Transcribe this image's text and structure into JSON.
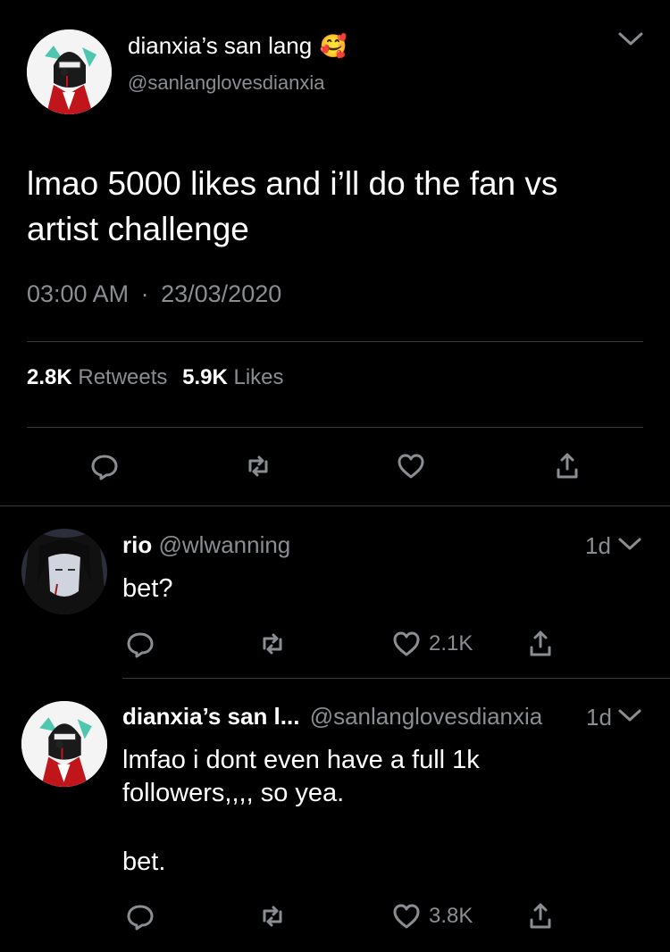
{
  "main_tweet": {
    "display_name": "dianxia’s san lang",
    "display_name_emoji": "🥰",
    "handle": "@sanlanglovesdianxia",
    "text_line1": "lmao 5000 likes and i’ll do the fan vs",
    "text_line2": "artist challenge",
    "time": "03:00 AM",
    "separator": "·",
    "date": "23/03/2020",
    "retweets_count": "2.8K",
    "retweets_label": "Retweets",
    "likes_count": "5.9K",
    "likes_label": "Likes"
  },
  "replies": [
    {
      "name": "rio",
      "handle": "@wlwanning",
      "age": "1d",
      "text": "bet?",
      "like_count": "2.1K"
    },
    {
      "name": "dianxia’s san l...",
      "handle": "@sanlanglovesdianxia",
      "age": "1d",
      "text_line1": "lmfao i dont even have a full 1k",
      "text_line2": "followers,,,, so yea.",
      "text_line3": "bet.",
      "like_count": "3.8K"
    }
  ],
  "colors": {
    "background": "#000000",
    "text": "#ffffff",
    "secondary": "#8a8d91",
    "divider": "#3a3b3e"
  }
}
